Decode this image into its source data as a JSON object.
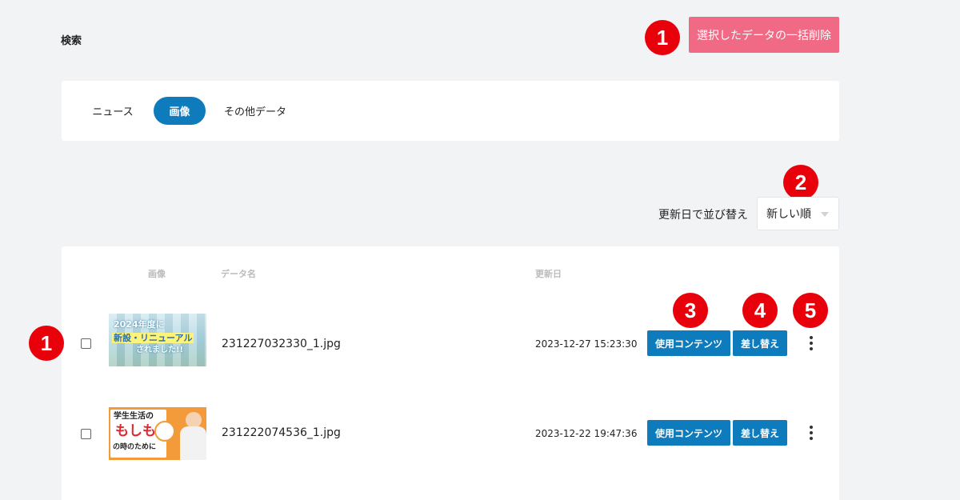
{
  "page": {
    "title": "検索"
  },
  "toolbar": {
    "bulk_delete_label": "選択したデータの一括削除"
  },
  "annotations": {
    "b1": "1",
    "b2": "2",
    "b3": "3",
    "b4": "4",
    "b5": "5"
  },
  "tabs": [
    {
      "label": "ニュース",
      "active": false
    },
    {
      "label": "画像",
      "active": true
    },
    {
      "label": "その他データ",
      "active": false
    }
  ],
  "sort": {
    "label": "更新日で並び替え",
    "selected": "新しい順"
  },
  "table": {
    "headers": {
      "image": "画像",
      "name": "データ名",
      "updated": "更新日"
    },
    "rows": [
      {
        "thumb_lines": [
          "2024年度に",
          "新設・リニューアル",
          "されました!!"
        ],
        "name": "231227032330_1.jpg",
        "updated": "2023-12-27 15:23:30",
        "usage_label": "使用コンテンツ",
        "replace_label": "差し替え"
      },
      {
        "thumb_lines": [
          "学生生活の",
          "もしも",
          "の時のために"
        ],
        "name": "231222074536_1.jpg",
        "updated": "2023-12-22 19:47:36",
        "usage_label": "使用コンテンツ",
        "replace_label": "差し替え"
      }
    ]
  },
  "colors": {
    "accent": "#0e7bbd",
    "danger": "#f06a86",
    "badge": "#e8000a"
  }
}
